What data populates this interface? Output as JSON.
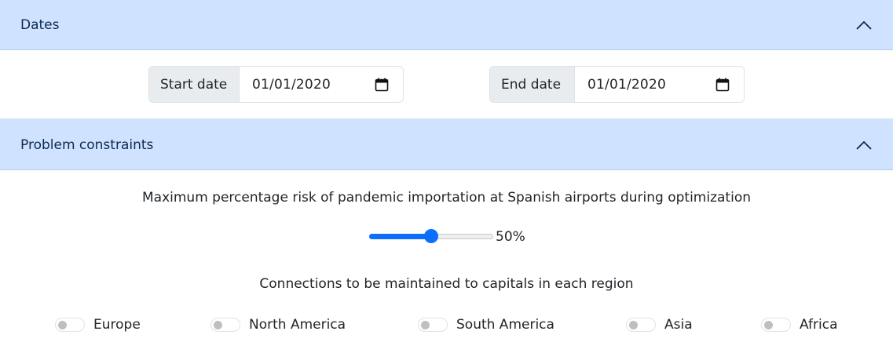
{
  "sections": {
    "dates": {
      "title": "Dates",
      "expanded": true
    },
    "constraints": {
      "title": "Problem constraints",
      "expanded": true
    }
  },
  "dates": {
    "start_label": "Start date",
    "start_value": "01/01/2020",
    "end_label": "End date",
    "end_value": "01/01/2020"
  },
  "risk": {
    "label": "Maximum percentage risk of pandemic importation at Spanish airports during optimization",
    "value": 50,
    "value_text": "50%",
    "min": 0,
    "max": 100
  },
  "connections": {
    "label": "Connections to be maintained to capitals in each region",
    "regions": [
      {
        "label": "Europe",
        "checked": false
      },
      {
        "label": "North America",
        "checked": false
      },
      {
        "label": "South America",
        "checked": false
      },
      {
        "label": "Asia",
        "checked": false
      },
      {
        "label": "Africa",
        "checked": false
      }
    ]
  },
  "colors": {
    "accordion_header_bg": "#cfe2ff",
    "accent": "#0d6efd"
  },
  "icons": {
    "collapse": "chevron-up-icon",
    "date_picker": "calendar-icon"
  }
}
